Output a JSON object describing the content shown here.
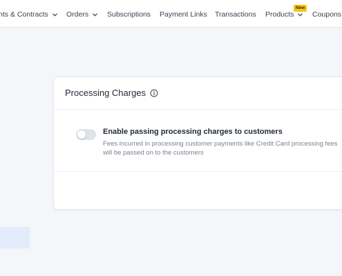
{
  "nav": {
    "items": [
      {
        "label": "nts & Contracts",
        "chevron": true
      },
      {
        "label": "Orders",
        "chevron": true
      },
      {
        "label": "Subscriptions",
        "chevron": false
      },
      {
        "label": "Payment Links",
        "chevron": false
      },
      {
        "label": "Transactions",
        "chevron": false
      },
      {
        "label": "Products",
        "chevron": true
      },
      {
        "label": "Coupons",
        "chevron": false
      }
    ],
    "new_badge": "New"
  },
  "card": {
    "title": "Processing Charges",
    "info_icon": "info-circle-icon",
    "setting": {
      "label": "Enable passing processing charges to customers",
      "description": "Fees incurred in processing customer payments like Credit Card processing fees will be passed on to the customers",
      "enabled": false
    }
  },
  "colors": {
    "accent_highlight": "#e3ecfb",
    "badge": "#f5c518"
  }
}
